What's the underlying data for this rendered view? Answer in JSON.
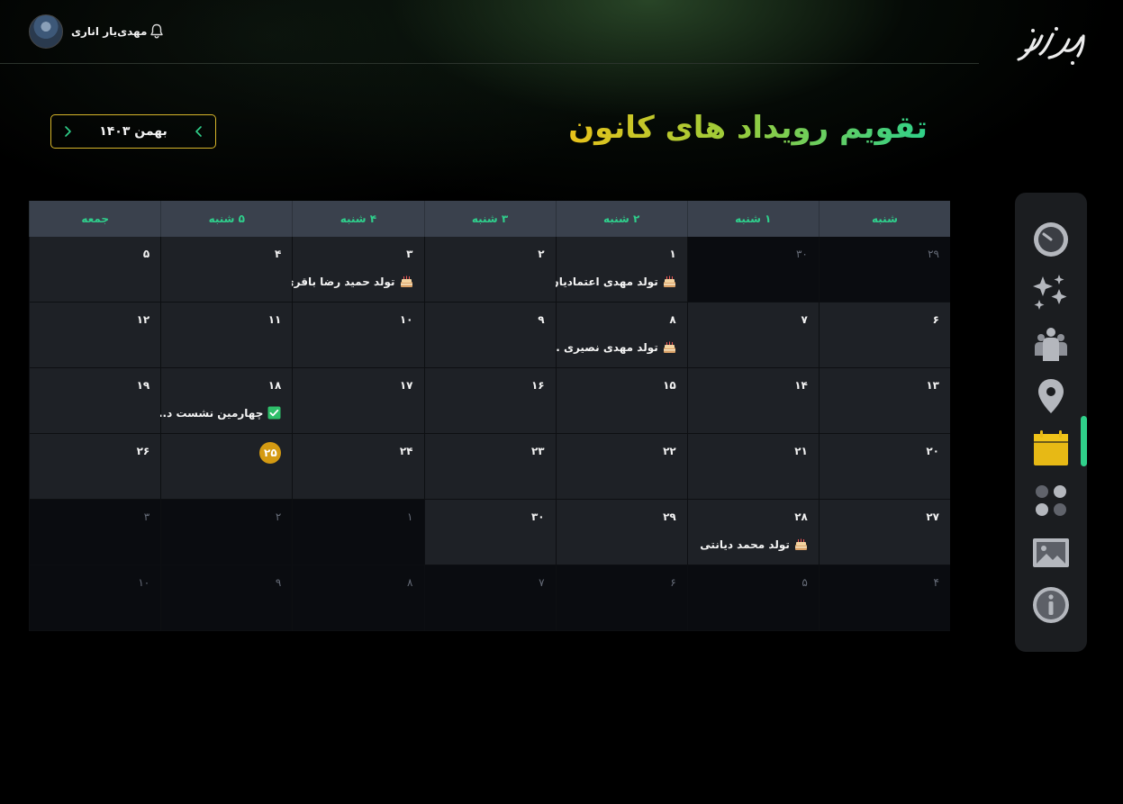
{
  "header": {
    "username": "مهدی‌یار اناری",
    "logo_text": "نیک‌ویز"
  },
  "page": {
    "title": "تقویم رویداد های کانون",
    "month_label": "بهمن ۱۴۰۳"
  },
  "calendar": {
    "weekdays": [
      "شنبه",
      "۱ شنبه",
      "۲ شنبه",
      "۳ شنبه",
      "۴ شنبه",
      "۵ شنبه",
      "جمعه"
    ],
    "weeks": [
      [
        {
          "day": "۲۹",
          "out": true
        },
        {
          "day": "۳۰",
          "out": true
        },
        {
          "day": "۱",
          "event": "تولد مهدی اعتمادیان",
          "icon": "cake-icon"
        },
        {
          "day": "۲"
        },
        {
          "day": "۳",
          "event": "تولد حمید رضا باقری",
          "icon": "cake-icon"
        },
        {
          "day": "۴"
        },
        {
          "day": "۵"
        }
      ],
      [
        {
          "day": "۶"
        },
        {
          "day": "۷"
        },
        {
          "day": "۸",
          "event": "تولد مهدی نصیری ...",
          "icon": "cake-icon"
        },
        {
          "day": "۹"
        },
        {
          "day": "۱۰"
        },
        {
          "day": "۱۱"
        },
        {
          "day": "۱۲"
        }
      ],
      [
        {
          "day": "۱۳"
        },
        {
          "day": "۱۴"
        },
        {
          "day": "۱۵"
        },
        {
          "day": "۱۶"
        },
        {
          "day": "۱۷"
        },
        {
          "day": "۱۸",
          "event": "چهارمین نشست د...",
          "icon": "check-icon"
        },
        {
          "day": "۱۹"
        }
      ],
      [
        {
          "day": "۲۰"
        },
        {
          "day": "۲۱"
        },
        {
          "day": "۲۲"
        },
        {
          "day": "۲۳"
        },
        {
          "day": "۲۴"
        },
        {
          "day": "۲۵",
          "today": true
        },
        {
          "day": "۲۶"
        }
      ],
      [
        {
          "day": "۲۷"
        },
        {
          "day": "۲۸",
          "event": "تولد محمد دیانتی",
          "icon": "cake-icon"
        },
        {
          "day": "۲۹"
        },
        {
          "day": "۳۰"
        },
        {
          "day": "۱",
          "out": true
        },
        {
          "day": "۲",
          "out": true
        },
        {
          "day": "۳",
          "out": true
        }
      ],
      [
        {
          "day": "۴",
          "out": true
        },
        {
          "day": "۵",
          "out": true
        },
        {
          "day": "۶",
          "out": true
        },
        {
          "day": "۷",
          "out": true
        },
        {
          "day": "۸",
          "out": true
        },
        {
          "day": "۹",
          "out": true
        },
        {
          "day": "۱۰",
          "out": true
        }
      ]
    ]
  },
  "sidebar": {
    "items": [
      {
        "icon": "dashboard-gauge-icon"
      },
      {
        "icon": "sparkles-icon"
      },
      {
        "icon": "people-icon"
      },
      {
        "icon": "location-pin-icon"
      },
      {
        "icon": "calendar-icon",
        "active": true
      },
      {
        "icon": "apps-dots-icon"
      },
      {
        "icon": "image-icon"
      },
      {
        "icon": "info-icon"
      }
    ]
  },
  "colors": {
    "accent_green": "#2fd08a",
    "accent_yellow": "#e8c21a",
    "today_badge": "#d49a12",
    "header_row": "#3a414d",
    "cell_bg": "#1e2126",
    "out_cell_bg": "#0a0c10"
  }
}
